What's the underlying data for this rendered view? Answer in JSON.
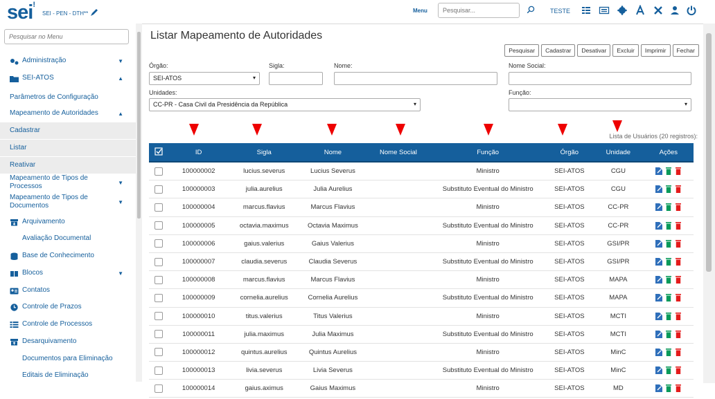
{
  "header": {
    "logo": "sei",
    "logo_mark": "!",
    "org": "SEI - PEN - DTH**",
    "menu": "Menu",
    "search_placeholder": "Pesquisar...",
    "user": "TESTE"
  },
  "sidebar": {
    "search_placeholder": "Pesquisar no Menu",
    "items": [
      {
        "label": "Administração",
        "icon": "gears-icon",
        "caret": "▼"
      },
      {
        "label": "SEI-ATOS",
        "icon": "folder-icon",
        "caret": "▲"
      },
      {
        "label": "Parâmetros de Configuração"
      },
      {
        "label": "Mapeamento de Autoridades",
        "caret": "▲"
      },
      {
        "label": "Cadastrar"
      },
      {
        "label": "Listar"
      },
      {
        "label": "Reativar"
      },
      {
        "label": "Mapeamento de Tipos de Processos",
        "caret": "▼"
      },
      {
        "label": "Mapeamento de Tipos de Documentos",
        "caret": "▼"
      },
      {
        "label": "Arquivamento",
        "icon": "archive-icon"
      },
      {
        "label": "Avaliação Documental"
      },
      {
        "label": "Base de Conhecimento",
        "icon": "database-icon"
      },
      {
        "label": "Blocos",
        "icon": "blocks-icon",
        "caret": "▼"
      },
      {
        "label": "Contatos",
        "icon": "contacts-icon"
      },
      {
        "label": "Controle de Prazos",
        "icon": "clock-icon"
      },
      {
        "label": "Controle de Processos",
        "icon": "list-icon"
      },
      {
        "label": "Desarquivamento",
        "icon": "unarchive-icon"
      },
      {
        "label": "Documentos para Eliminação"
      },
      {
        "label": "Editais de Eliminação"
      }
    ]
  },
  "page": {
    "title": "Listar Mapeamento de Autoridades",
    "buttons": [
      "Pesquisar",
      "Cadastrar",
      "Desativar",
      "Excluir",
      "Imprimir",
      "Fechar"
    ],
    "filters": {
      "orgao_label": "Órgão:",
      "orgao_value": "SEI-ATOS",
      "sigla_label": "Sigla:",
      "nome_label": "Nome:",
      "nome_social_label": "Nome Social:",
      "unidades_label": "Unidades:",
      "unidades_value": "CC-PR - Casa Civil da Presidência da República",
      "funcao_label": "Função:"
    },
    "list_caption": "Lista de Usuários (20 registros):"
  },
  "table": {
    "columns": [
      "ID",
      "Sigla",
      "Nome",
      "Nome Social",
      "Função",
      "Órgão",
      "Unidade",
      "Ações"
    ],
    "rows": [
      [
        "100000002",
        "lucius.severus",
        "Lucius Severus",
        "",
        "Ministro",
        "SEI-ATOS",
        "CGU"
      ],
      [
        "100000003",
        "julia.aurelius",
        "Julia Aurelius",
        "",
        "Substituto Eventual do Ministro",
        "SEI-ATOS",
        "CGU"
      ],
      [
        "100000004",
        "marcus.flavius",
        "Marcus Flavius",
        "",
        "Ministro",
        "SEI-ATOS",
        "CC-PR"
      ],
      [
        "100000005",
        "octavia.maximus",
        "Octavia Maximus",
        "",
        "Substituto Eventual do Ministro",
        "SEI-ATOS",
        "CC-PR"
      ],
      [
        "100000006",
        "gaius.valerius",
        "Gaius Valerius",
        "",
        "Ministro",
        "SEI-ATOS",
        "GSI/PR"
      ],
      [
        "100000007",
        "claudia.severus",
        "Claudia Severus",
        "",
        "Substituto Eventual do Ministro",
        "SEI-ATOS",
        "GSI/PR"
      ],
      [
        "100000008",
        "marcus.flavius",
        "Marcus Flavius",
        "",
        "Ministro",
        "SEI-ATOS",
        "MAPA"
      ],
      [
        "100000009",
        "cornelia.aurelius",
        "Cornelia Aurelius",
        "",
        "Substituto Eventual do Ministro",
        "SEI-ATOS",
        "MAPA"
      ],
      [
        "100000010",
        "titus.valerius",
        "Titus Valerius",
        "",
        "Ministro",
        "SEI-ATOS",
        "MCTI"
      ],
      [
        "100000011",
        "julia.maximus",
        "Julia Maximus",
        "",
        "Substituto Eventual do Ministro",
        "SEI-ATOS",
        "MCTI"
      ],
      [
        "100000012",
        "quintus.aurelius",
        "Quintus Aurelius",
        "",
        "Ministro",
        "SEI-ATOS",
        "MinC"
      ],
      [
        "100000013",
        "livia.severus",
        "Livia Severus",
        "",
        "Substituto Eventual do Ministro",
        "SEI-ATOS",
        "MinC"
      ],
      [
        "100000014",
        "gaius.aximus",
        "Gaius Maximus",
        "",
        "Ministro",
        "SEI-ATOS",
        "MD"
      ]
    ]
  },
  "colors": {
    "primary": "#155f9c",
    "marker": "#e00000",
    "edit": "#2f6fba",
    "delete": "#e41b1b",
    "deactivate": "#0a9a5a"
  }
}
